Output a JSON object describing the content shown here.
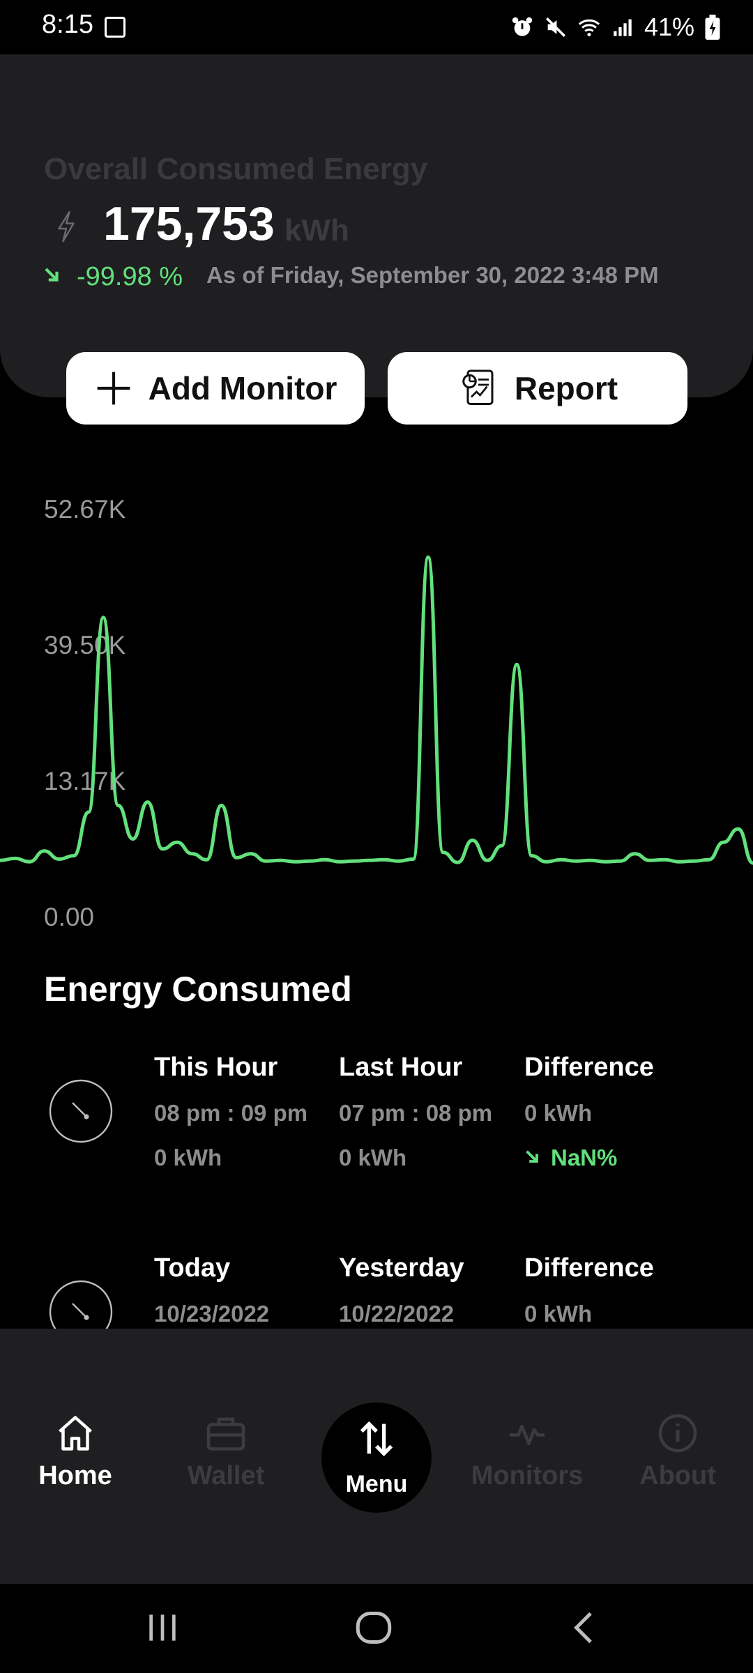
{
  "status_bar": {
    "time": "8:15",
    "battery": "41%",
    "icons": [
      "gallery-icon",
      "alarm-icon",
      "mute-icon",
      "wifi-icon",
      "signal-icon",
      "battery-charging-icon"
    ]
  },
  "header": {
    "title": "Overall Consumed Energy",
    "value": "175,753",
    "unit": "kWh",
    "change": "-99.98 %",
    "as_of": "As of Friday, September 30, 2022 3:48 PM",
    "icons": [
      "bolt-icon",
      "down-right-arrow-icon"
    ]
  },
  "buttons": {
    "add_monitor": "Add Monitor",
    "report": "Report"
  },
  "chart_data": {
    "type": "line",
    "y_ticks": [
      "52.67K",
      "39.50K",
      "13.17K",
      "0.00"
    ],
    "series_color": "#62e07c",
    "values": [
      800,
      1100,
      600,
      2200,
      1000,
      1500,
      8000,
      37000,
      9000,
      4000,
      9500,
      2500,
      3500,
      1800,
      900,
      9000,
      1200,
      1800,
      700,
      800,
      600,
      700,
      900,
      600,
      700,
      800,
      900,
      700,
      1000,
      46000,
      2000,
      500,
      3800,
      800,
      3000,
      30000,
      1500,
      600,
      900,
      700,
      800,
      600,
      700,
      1800,
      800,
      900,
      600,
      700,
      900,
      3500,
      5500,
      400
    ],
    "grid": false
  },
  "energy_consumed": {
    "title": "Energy Consumed",
    "rows": [
      {
        "col1": {
          "head": "This Hour",
          "line1": "08 pm : 09 pm",
          "line2": "0 kWh"
        },
        "col2": {
          "head": "Last Hour",
          "line1": "07 pm : 08 pm",
          "line2": "0 kWh"
        },
        "col3": {
          "head": "Difference",
          "line1": "0 kWh",
          "line2": "NaN%"
        }
      },
      {
        "col1": {
          "head": "Today",
          "line1": "10/23/2022"
        },
        "col2": {
          "head": "Yesterday",
          "line1": "10/22/2022"
        },
        "col3": {
          "head": "Difference",
          "line1": "0 kWh"
        }
      }
    ]
  },
  "bottom_nav": {
    "items": [
      {
        "label": "Home",
        "icon": "home-icon",
        "active": true
      },
      {
        "label": "Wallet",
        "icon": "wallet-icon",
        "active": false
      },
      {
        "label": "Menu",
        "icon": "sort-arrows-icon",
        "active": true
      },
      {
        "label": "Monitors",
        "icon": "pulse-icon",
        "active": false
      },
      {
        "label": "About",
        "icon": "info-icon",
        "active": false
      }
    ]
  },
  "system_nav": [
    "recents-icon",
    "home-circle-icon",
    "back-icon"
  ],
  "colors": {
    "accent_green": "#62e07c",
    "card_bg": "#1f1f21",
    "muted_text": "#8d8d8f"
  }
}
